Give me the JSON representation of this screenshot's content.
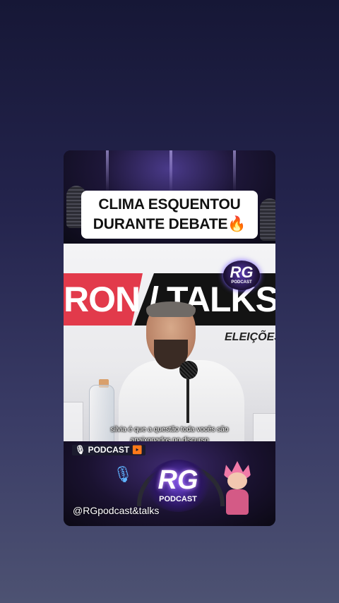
{
  "video": {
    "headline_line1": "CLIMA ESQUENTOU",
    "headline_line2": "DURANTE DEBATE",
    "headline_emoji": "🔥",
    "banner_left": "RON",
    "banner_slash": "/",
    "banner_right": "TALKS",
    "banner_sub": "ELEIÇÕES",
    "logo_small_text": "RG",
    "logo_small_sub": "PODCAST",
    "subtitle_line1": "silvia é que a questão toda vocês são",
    "subtitle_line2": "apaixonados no discurso",
    "podcast_tag": "PODCAST",
    "podcast_tag_play": "▶",
    "logo_main_text": "RG",
    "logo_main_sub": "PODCAST",
    "watermark": "@RGpodcast&talks"
  },
  "icons": {
    "mic": "microphone-icon",
    "fire": "fire-emoji",
    "play": "play-icon"
  },
  "colors": {
    "banner_red": "#e23a4b",
    "banner_black": "#131313",
    "accent_orange": "#ff7a1a"
  }
}
